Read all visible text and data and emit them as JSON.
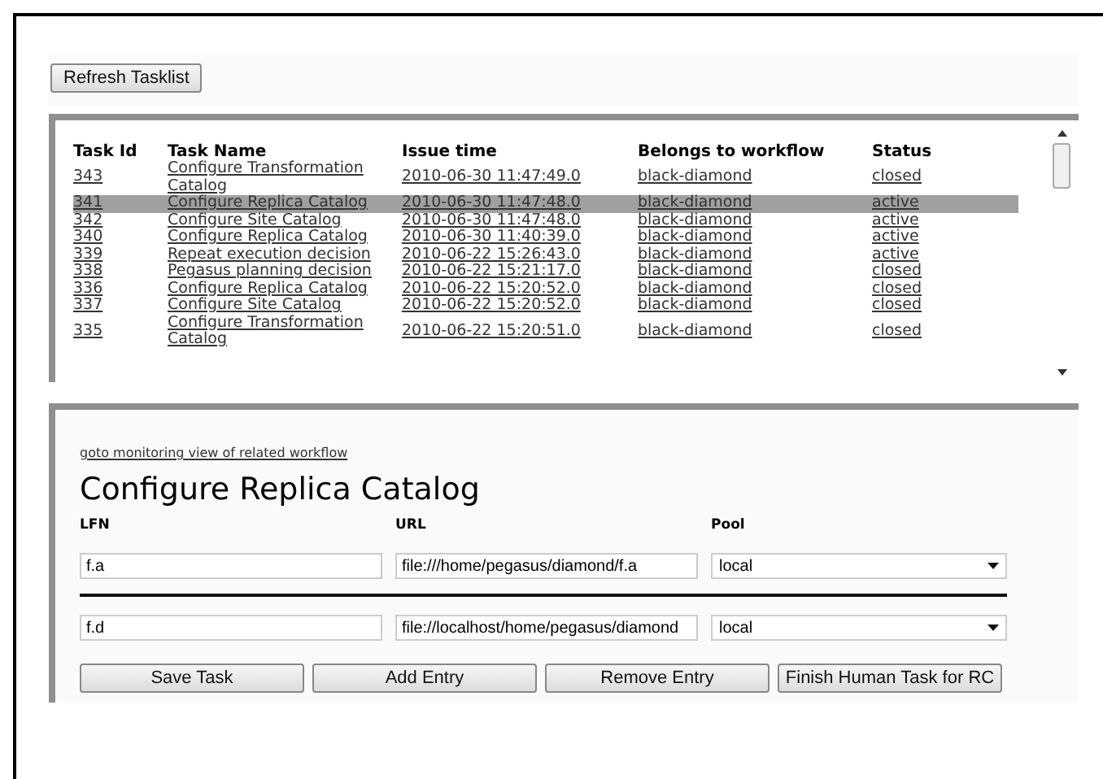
{
  "refresh_button": "Refresh Tasklist",
  "task_table": {
    "columns": [
      "Task Id",
      "Task Name",
      "Issue time",
      "Belongs to workflow",
      "Status"
    ],
    "rows": [
      {
        "id": "343",
        "name": "Configure Transformation Catalog",
        "issued": "2010-06-30 11:47:49.0",
        "workflow": "black-diamond",
        "status": "closed",
        "selected": false
      },
      {
        "id": "341",
        "name": "Configure Replica Catalog",
        "issued": "2010-06-30 11:47:48.0",
        "workflow": "black-diamond",
        "status": "active",
        "selected": true
      },
      {
        "id": "342",
        "name": "Configure Site Catalog",
        "issued": "2010-06-30 11:47:48.0",
        "workflow": "black-diamond",
        "status": "active",
        "selected": false
      },
      {
        "id": "340",
        "name": "Configure Replica Catalog",
        "issued": "2010-06-30 11:40:39.0",
        "workflow": "black-diamond",
        "status": "active",
        "selected": false
      },
      {
        "id": "339",
        "name": "Repeat execution decision",
        "issued": "2010-06-22 15:26:43.0",
        "workflow": "black-diamond",
        "status": "active",
        "selected": false
      },
      {
        "id": "338",
        "name": "Pegasus planning decision",
        "issued": "2010-06-22 15:21:17.0",
        "workflow": "black-diamond",
        "status": "closed",
        "selected": false
      },
      {
        "id": "336",
        "name": "Configure Replica Catalog",
        "issued": "2010-06-22 15:20:52.0",
        "workflow": "black-diamond",
        "status": "closed",
        "selected": false
      },
      {
        "id": "337",
        "name": "Configure Site Catalog",
        "issued": "2010-06-22 15:20:52.0",
        "workflow": "black-diamond",
        "status": "closed",
        "selected": false
      },
      {
        "id": "335",
        "name": "Configure Transformation Catalog",
        "issued": "2010-06-22 15:20:51.0",
        "workflow": "black-diamond",
        "status": "closed",
        "selected": false
      }
    ]
  },
  "detail": {
    "monitor_link": "goto monitoring view of related workflow",
    "title": "Configure Replica Catalog",
    "columns": [
      "LFN",
      "URL",
      "Pool"
    ],
    "entries": [
      {
        "lfn": "f.a",
        "url": "file:///home/pegasus/diamond/f.a",
        "pool": "local"
      },
      {
        "lfn": "f.d",
        "url": "file://localhost/home/pegasus/diamond",
        "pool": "local"
      }
    ],
    "buttons": [
      "Save Task",
      "Add Entry",
      "Remove Entry",
      "Finish Human Task for RC"
    ]
  }
}
